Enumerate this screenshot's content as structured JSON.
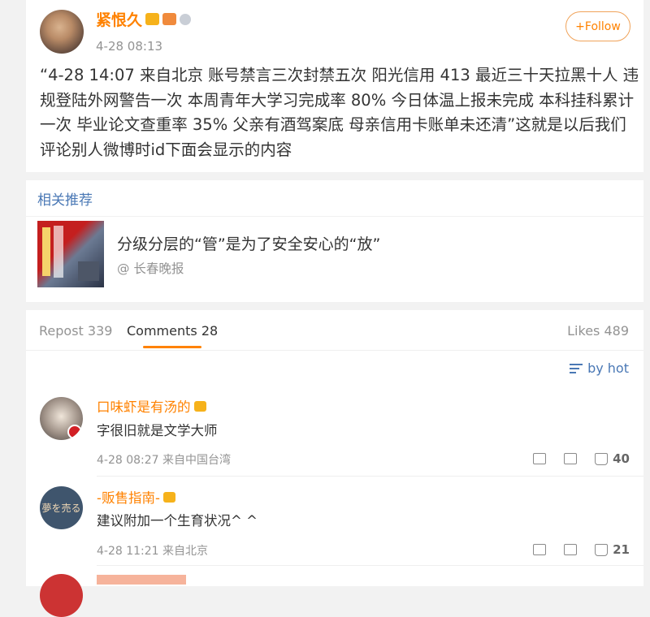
{
  "post": {
    "author": "紧恨久",
    "time": "4-28 08:13",
    "follow_label": "+Follow",
    "text": "“4-28 14:07 来自北京 账号禁言三次封禁五次 阳光信用 413 最近三十天拉黑十人 违规登陆外网警告一次 本周青年大学习完成率 80% 今日体温上报未完成 本科挂科累计一次 毕业论文查重率 35% 父亲有酒驾案底 母亲信用卡账单未还清”这就是以后我们评论别人微博时id下面会显示的内容"
  },
  "related": {
    "section_title": "相关推荐",
    "headline": "分级分层的“管”是为了安全安心的“放”",
    "source": "@ 长春晚报"
  },
  "tabs": {
    "repost": "Repost 339",
    "comments": "Comments 28",
    "likes": "Likes 489"
  },
  "sort_label": "by hot",
  "comments": [
    {
      "name": "口味虾是有汤的",
      "text": "字很旧就是文学大师",
      "meta": "4-28 08:27 来自中国台湾",
      "likes": "40"
    },
    {
      "name": "-贩售指南-",
      "text": "建议附加一个生育状况^ ^",
      "meta": "4-28 11:21 来自北京",
      "likes": "21",
      "avatar_text": "夢を売る"
    }
  ],
  "icons": [
    "share-icon",
    "comment-icon",
    "like-icon",
    "sort-icon",
    "vip-badge-icon"
  ]
}
